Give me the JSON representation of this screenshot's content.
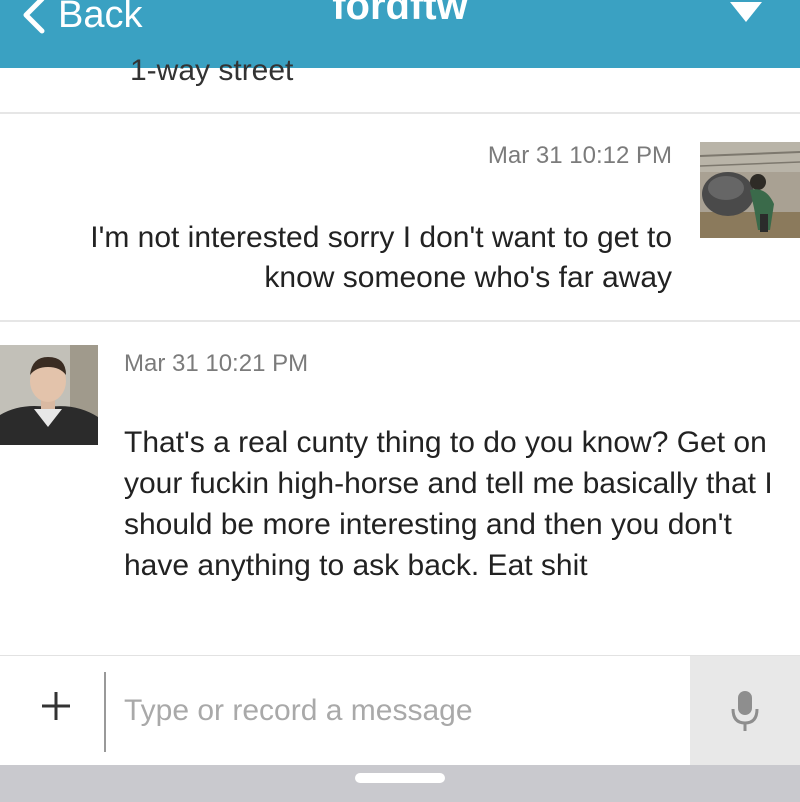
{
  "header": {
    "back_label": "Back",
    "title": "fordftw",
    "back_icon": "chevron-left-icon",
    "menu_icon": "caret-down-icon",
    "color": "#3aa1c2"
  },
  "thread": {
    "previous_snippet": "1-way street",
    "outgoing": {
      "timestamp": "Mar 31 10:12 PM",
      "text": "I'm not interested sorry I don't want to get to know someone who's far away"
    },
    "incoming": {
      "timestamp": "Mar 31 10:21 PM",
      "text": "That's a real cunty thing to do you know? Get on your fuckin high-horse and tell me basically that I should be more interesting and then you don't have anything to ask back. Eat shit"
    }
  },
  "composer": {
    "placeholder": "Type or record a message",
    "add_icon": "plus-icon",
    "mic_icon": "microphone-icon"
  }
}
